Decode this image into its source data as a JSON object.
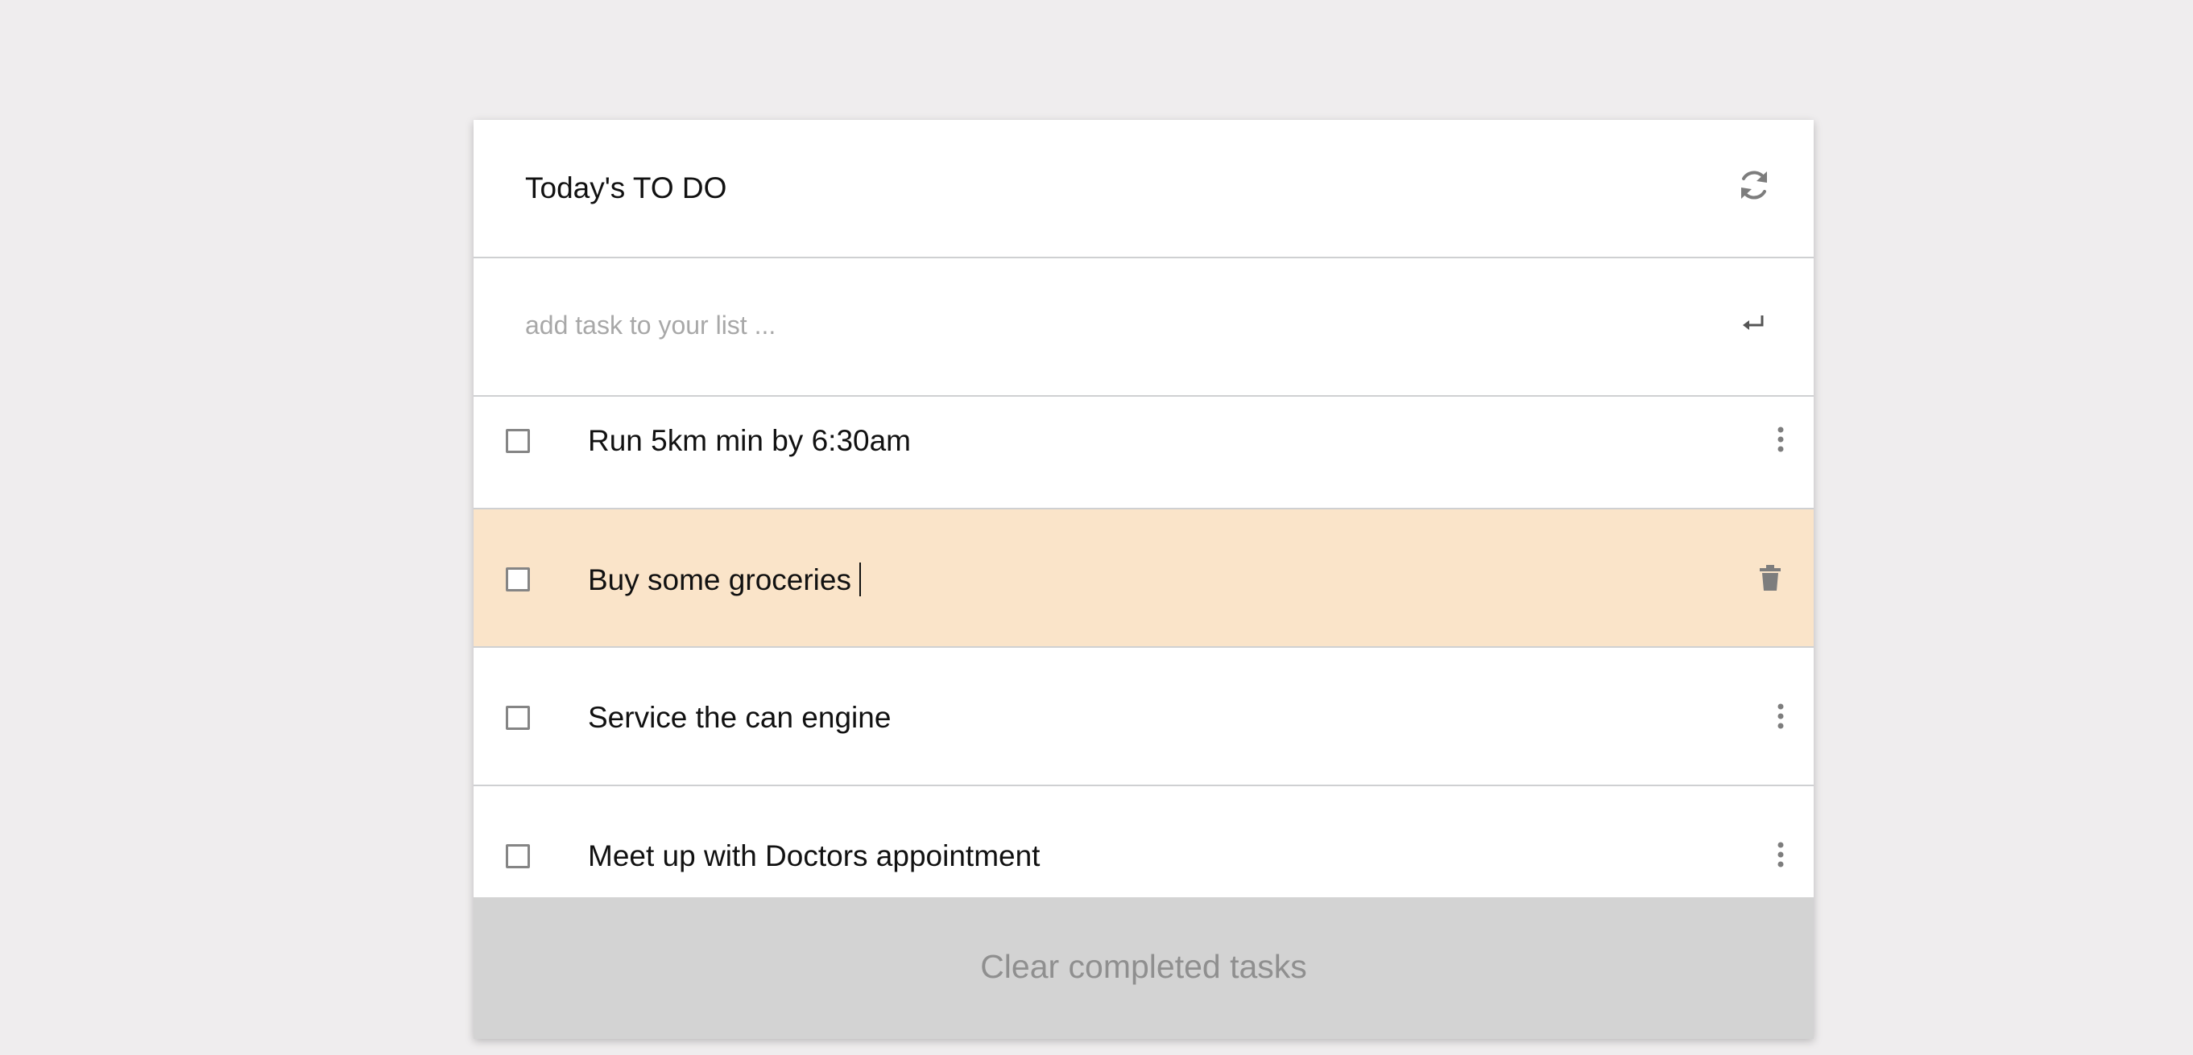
{
  "header": {
    "title": "Today's TO DO",
    "refresh_icon": "refresh-icon"
  },
  "add_task": {
    "value": "",
    "placeholder": "add task to your list ...",
    "submit_icon": "enter-return-icon"
  },
  "tasks": [
    {
      "text": "Run 5km min by 6:30am",
      "checked": false,
      "action_icon": "more-vertical-icon"
    },
    {
      "text": "Buy some groceries",
      "checked": false,
      "action_icon": "trash-icon",
      "highlighted": true
    },
    {
      "text": "Service the can engine",
      "checked": false,
      "action_icon": "more-vertical-icon"
    },
    {
      "text": "Meet up with Doctors appointment",
      "checked": false,
      "action_icon": "more-vertical-icon"
    }
  ],
  "footer": {
    "clear_label": "Clear completed tasks"
  },
  "colors": {
    "page_background": "#efedee",
    "card_background": "#ffffff",
    "highlight_row": "#fae4c9",
    "footer_background": "#d3d3d3",
    "icon_gray": "#7d7d7d"
  }
}
